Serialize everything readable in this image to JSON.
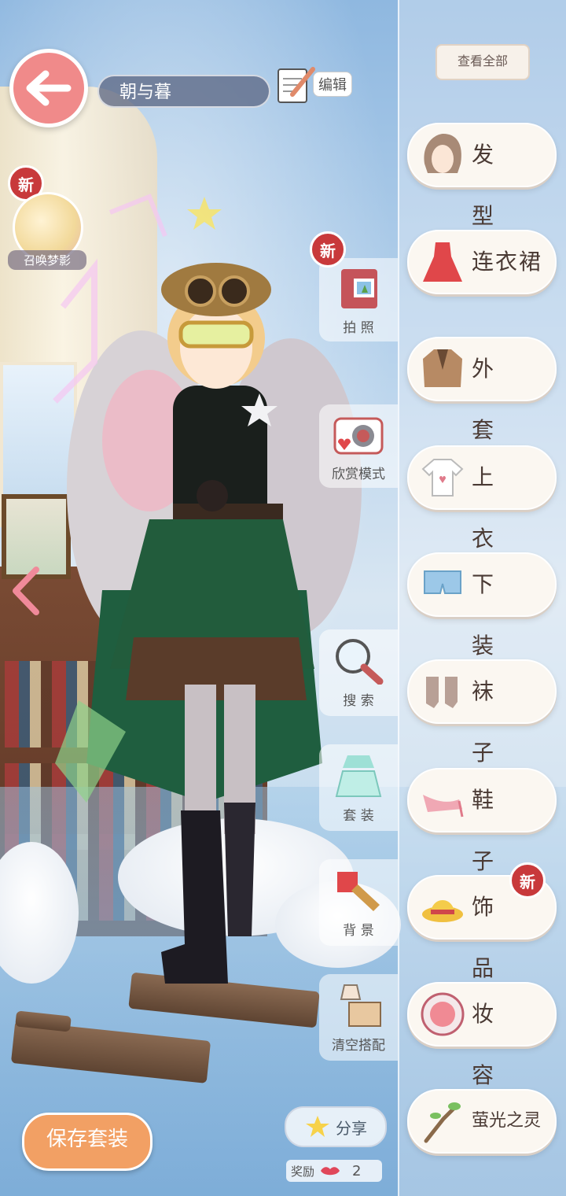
{
  "header": {
    "outfit_name": "朝与暮",
    "edit_label": "编辑"
  },
  "summon": {
    "new_badge": "新",
    "label": "召唤梦影"
  },
  "middle_actions": {
    "photo": {
      "label": "拍 照",
      "new_badge": "新"
    },
    "appreciate": {
      "label": "欣赏模式"
    },
    "search": {
      "label": "搜 索"
    },
    "suit": {
      "label": "套 装"
    },
    "background": {
      "label": "背 景"
    },
    "clear": {
      "label": "清空搭配"
    }
  },
  "panel": {
    "view_all": "查看全部",
    "categories": [
      {
        "label": "发 型",
        "icon": "hair-icon"
      },
      {
        "label": "连衣裙",
        "icon": "dress-icon"
      },
      {
        "label": "外 套",
        "icon": "coat-icon"
      },
      {
        "label": "上 衣",
        "icon": "shirt-icon"
      },
      {
        "label": "下 装",
        "icon": "pants-icon"
      },
      {
        "label": "袜 子",
        "icon": "socks-icon"
      },
      {
        "label": "鞋 子",
        "icon": "shoes-icon"
      },
      {
        "label": "饰 品",
        "icon": "hat-icon",
        "new_badge": "新"
      },
      {
        "label": "妆 容",
        "icon": "makeup-icon"
      },
      {
        "label": "萤光之灵",
        "icon": "branch-icon"
      }
    ]
  },
  "bottom": {
    "save_label": "保存套装",
    "share_label": "分享",
    "reward_label": "奖励",
    "reward_count": "2"
  },
  "colors": {
    "accent_red": "#c8393b",
    "save_orange": "#f2a064",
    "back_pink": "#f08a8a"
  }
}
